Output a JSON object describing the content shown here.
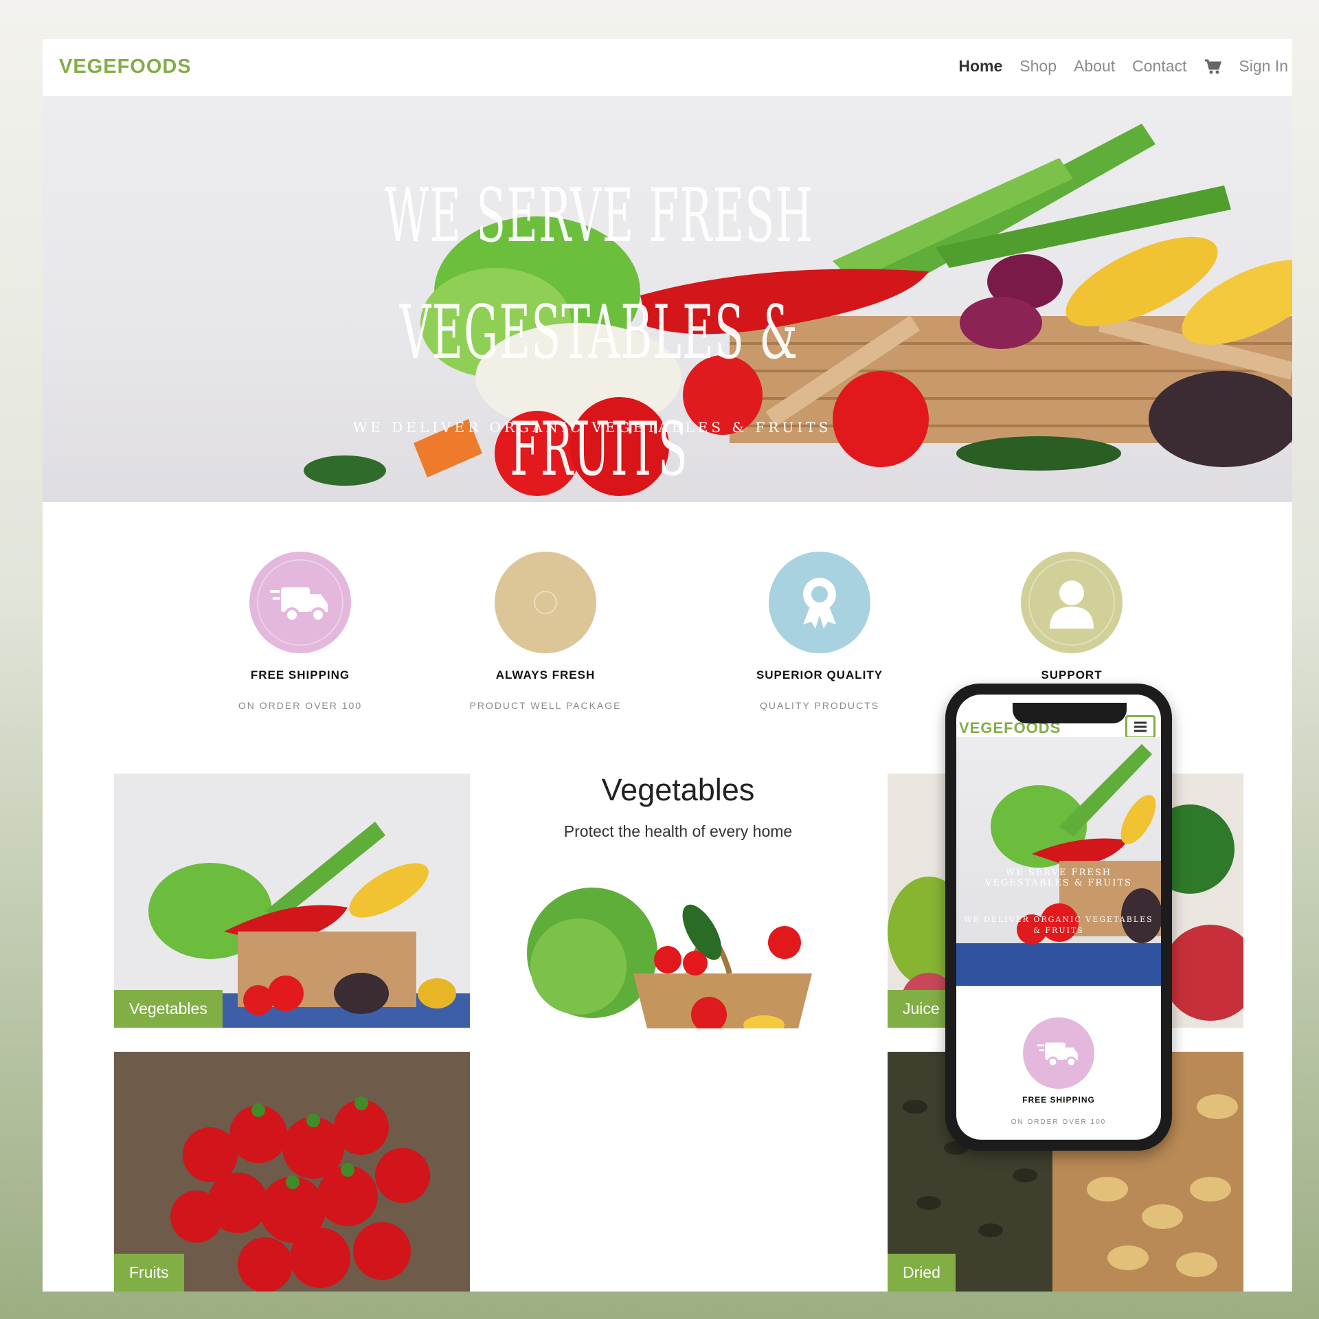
{
  "nav": {
    "brand": "VEGEFOODS",
    "links": [
      "Home",
      "Shop",
      "About",
      "Contact"
    ],
    "sign_in": "Sign In",
    "cart_icon": "cart-icon"
  },
  "hero": {
    "title": "We serve Fresh Vegestables & Fruits",
    "subtitle": "We deliver organic vegetables & fruits"
  },
  "features": [
    {
      "title": "FREE SHIPPING",
      "subtitle": "ON ORDER OVER 100",
      "icon": "truck-icon",
      "color": "#e3b8dc"
    },
    {
      "title": "ALWAYS FRESH",
      "subtitle": "PRODUCT WELL PACKAGE",
      "icon": "fresh-icon",
      "color": "#dcc698"
    },
    {
      "title": "SUPERIOR QUALITY",
      "subtitle": "QUALITY PRODUCTS",
      "icon": "award-icon",
      "color": "#a8d2e0"
    },
    {
      "title": "SUPPORT",
      "subtitle": "",
      "icon": "user-icon",
      "color": "#d2d099"
    }
  ],
  "categories": {
    "center_title": "Vegetables",
    "center_subtitle": "Protect the health of every home",
    "items": [
      "Vegetables",
      "Fruits",
      "Juice",
      "Dried"
    ]
  },
  "phone": {
    "brand": "VEGEFOODS",
    "hero_title": "We serve Fresh Vegestables & Fruits",
    "hero_subtitle": "We deliver organic vegetables & fruits",
    "feature_title": "FREE SHIPPING",
    "feature_subtitle": "ON ORDER OVER 100"
  },
  "colors": {
    "accent": "#82ae46"
  }
}
